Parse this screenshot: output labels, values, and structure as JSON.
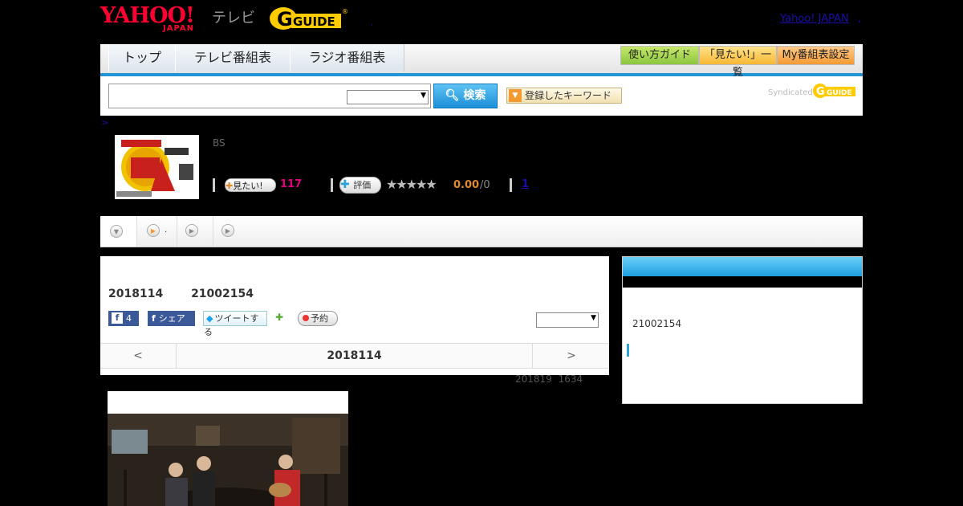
{
  "header": {
    "yahoo_logo": "YAHOO!",
    "yahoo_sub": "JAPAN",
    "tv_label": "テレビ",
    "gguide_logo": "G GUIDE",
    "yahoo_japan_link": "Yahoo! JAPAN",
    "dot_left": ",",
    "dot_right": ","
  },
  "nav": {
    "tabs": [
      {
        "label": "トップ"
      },
      {
        "label": "テレビ番組表"
      },
      {
        "label": "ラジオ番組表"
      }
    ],
    "right_buttons": [
      {
        "label": "使い方ガイド"
      },
      {
        "label": "「見たい!」一覧"
      },
      {
        "label": "My番組表設定"
      }
    ]
  },
  "search": {
    "input_value": "",
    "select_value": "",
    "button_label": "検索",
    "keyword_button": "登録したキーワード",
    "syndicated_label": "Syndicated"
  },
  "breadcrumb": {
    "text": ">"
  },
  "program": {
    "channel_label": "BS",
    "mitai_label": "見たい!",
    "mitai_count": "117",
    "hyoka_label": "評価",
    "stars": "★★★★★",
    "rating_value": "0.00",
    "rating_count": "/0",
    "link_one": "1"
  },
  "tabs_bar": {
    "tab2_text": "."
  },
  "main": {
    "date_title": "2018114 21002154",
    "fb_count": "4",
    "fb_share_label": "シェア",
    "tweet_label": "ツイートする",
    "yoyaku_label": "予約",
    "panel_select_value": "",
    "datenav_prev": "<",
    "datenav_current": "2018114",
    "datenav_next": ">",
    "updated_text": "201819 1634"
  },
  "sidebar": {
    "time_text": "21002154"
  },
  "colors": {
    "accent_blue": "#2196d7",
    "mitai_pink": "#e4007f",
    "rating_orange": "#e08a2e",
    "facebook": "#3b5998"
  }
}
